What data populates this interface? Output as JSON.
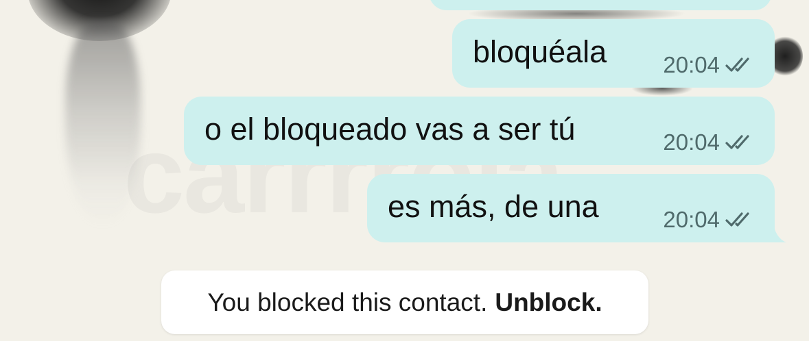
{
  "chat": {
    "messages": [
      {
        "text": "bloquéala",
        "time": "20:04",
        "status": "read"
      },
      {
        "text": "o el bloqueado vas a ser tú",
        "time": "20:04",
        "status": "read"
      },
      {
        "text": "es más, de una",
        "time": "20:04",
        "status": "read"
      }
    ],
    "blocked_notice": {
      "text": "You blocked this contact.",
      "action_label": "Unblock."
    }
  },
  "watermark": "carrrrola",
  "colors": {
    "outgoing_bubble": "#cdf0ee",
    "background": "#f3f1e9",
    "notice_background": "#ffffff",
    "time_text": "#4f6a6b"
  },
  "icons": {
    "read_receipt": "double-check-icon"
  }
}
